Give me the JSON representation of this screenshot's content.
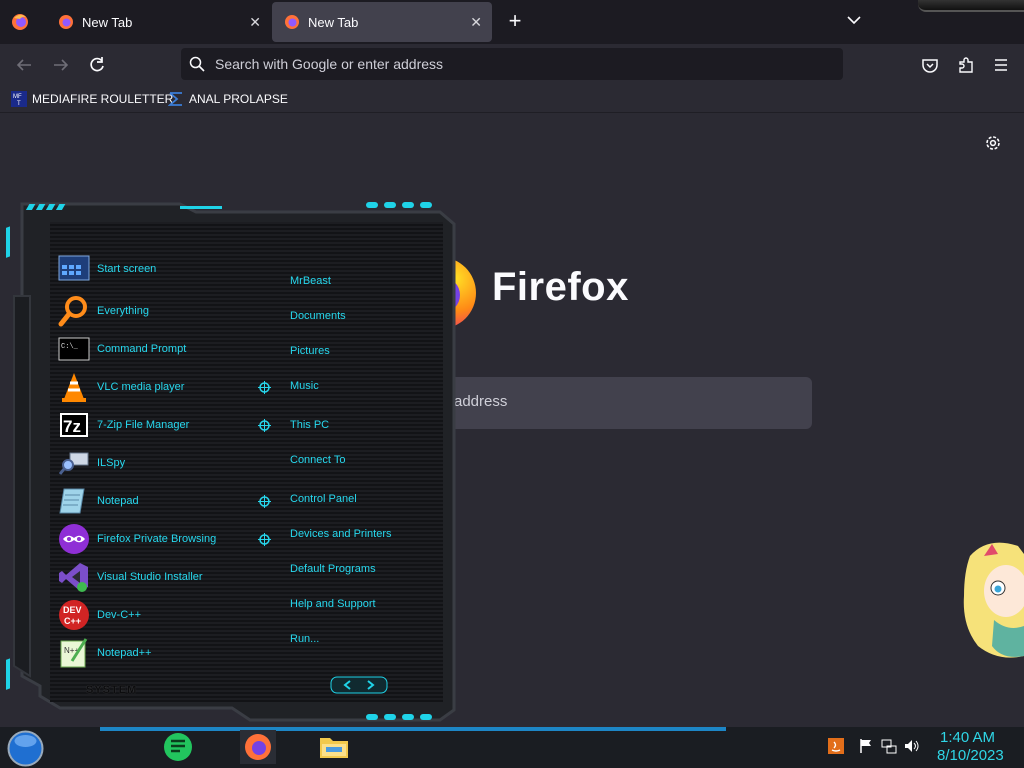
{
  "browser": {
    "tabs": [
      {
        "title": "New Tab",
        "active": false
      },
      {
        "title": "New Tab",
        "active": true
      }
    ],
    "address_placeholder": "Search with Google or enter address",
    "bookmarks": [
      {
        "label": "MEDIAFIRE ROULETTER",
        "icon": "mediafire-icon"
      },
      {
        "label": "ANAL PROLAPSE",
        "icon": "bookmark-sigma-icon"
      }
    ]
  },
  "newtab": {
    "brand": "Firefox",
    "search_placeholder_visible": "address"
  },
  "start_menu": {
    "programs": [
      {
        "label": "Start screen",
        "icon": "start-screen-icon"
      },
      {
        "label": "Everything",
        "icon": "magnifier-icon"
      },
      {
        "label": "Command Prompt",
        "icon": "terminal-icon"
      },
      {
        "label": "VLC media player",
        "icon": "vlc-cone-icon"
      },
      {
        "label": "7-Zip File Manager",
        "icon": "7zip-icon"
      },
      {
        "label": "ILSpy",
        "icon": "ilspy-icon"
      },
      {
        "label": "Notepad",
        "icon": "notepad-icon"
      },
      {
        "label": "Firefox Private Browsing",
        "icon": "private-browsing-icon"
      },
      {
        "label": "Visual Studio Installer",
        "icon": "visual-studio-icon"
      },
      {
        "label": "Dev-C++",
        "icon": "devcpp-icon"
      },
      {
        "label": "Notepad++",
        "icon": "notepadpp-icon"
      }
    ],
    "places": [
      {
        "label": "MrBeast",
        "has_submenu": false
      },
      {
        "label": "Documents",
        "has_submenu": false
      },
      {
        "label": "Pictures",
        "has_submenu": false
      },
      {
        "label": "Music",
        "has_submenu": true
      },
      {
        "label": "This PC",
        "has_submenu": true
      },
      {
        "label": "Connect To",
        "has_submenu": false
      },
      {
        "label": "Control Panel",
        "has_submenu": true
      },
      {
        "label": "Devices and Printers",
        "has_submenu": true
      },
      {
        "label": "Default Programs",
        "has_submenu": false
      },
      {
        "label": "Help and Support",
        "has_submenu": false
      },
      {
        "label": "Run...",
        "has_submenu": false
      }
    ],
    "system_label": "SYSTEM"
  },
  "taskbar": {
    "apps": [
      "notes-app-icon",
      "firefox-icon",
      "file-explorer-icon"
    ],
    "tray_icons": [
      "java-icon",
      "flag-icon",
      "network-icon",
      "volume-icon"
    ],
    "time": "1:40 AM",
    "date": "8/10/2023"
  },
  "colors": {
    "accent_cyan": "#27d8ee",
    "chrome_dark": "#1c1b22",
    "content_bg": "#2b2a33"
  }
}
